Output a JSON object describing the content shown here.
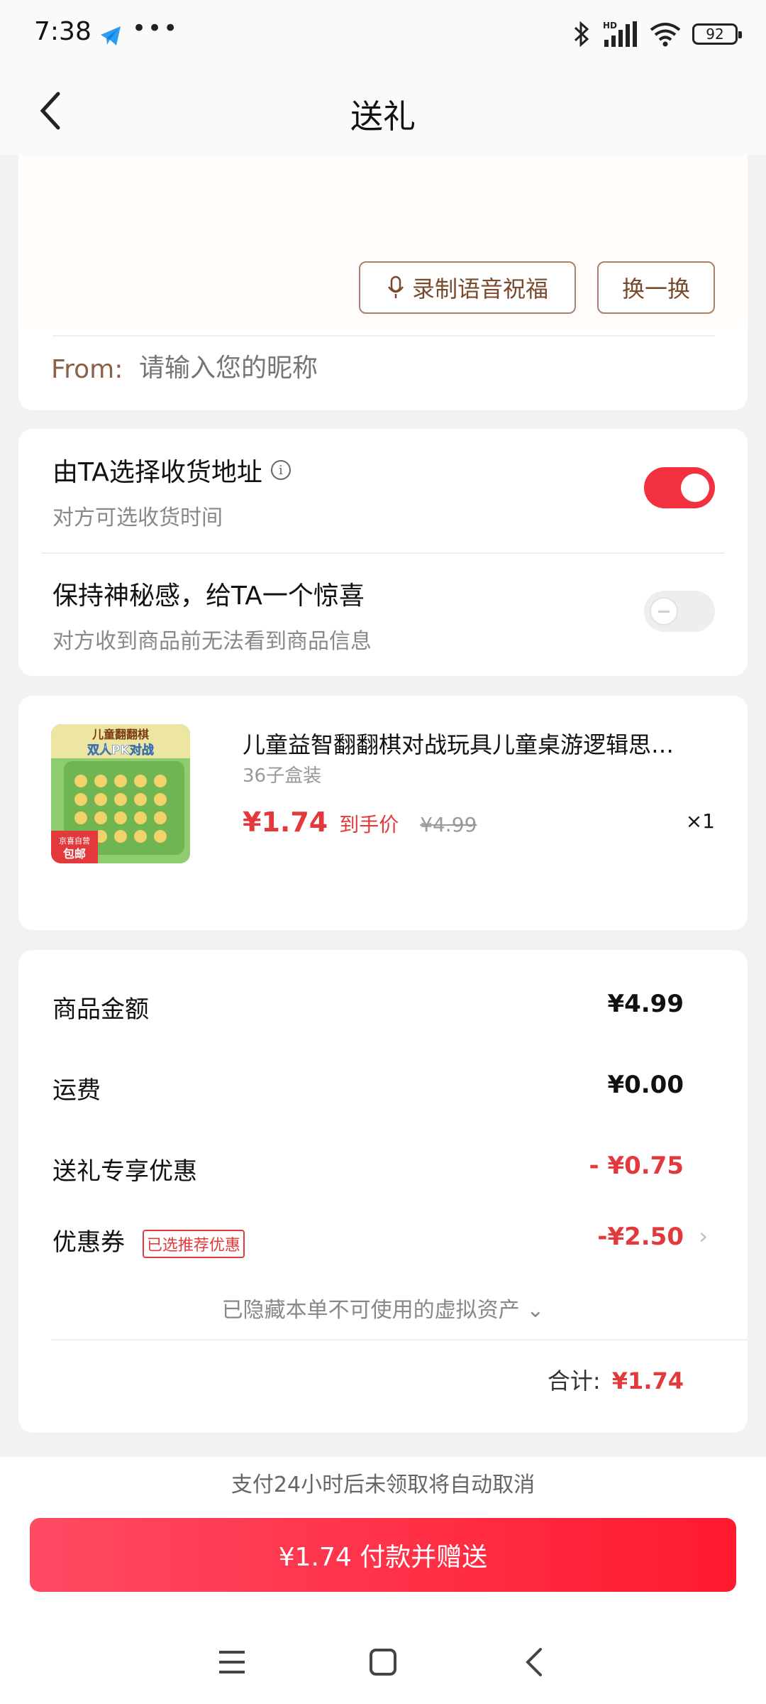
{
  "status_bar": {
    "time": "7:38",
    "more": "•••",
    "battery": "92",
    "network": "HD"
  },
  "nav": {
    "title": "送礼"
  },
  "message": {
    "record_button": "录制语音祝福",
    "switch_button": "换一换",
    "from_label": "From:",
    "from_placeholder": "请输入您的昵称"
  },
  "options": {
    "address": {
      "title": "由TA选择收货地址",
      "subtitle": "对方可选收货时间",
      "enabled": true
    },
    "mystery": {
      "title": "保持神秘感，给TA一个惊喜",
      "subtitle": "对方收到商品前无法看到商品信息",
      "enabled": false
    }
  },
  "product": {
    "image_text_top": "儿童翻翻棋",
    "image_text_mid": "双人PK对战",
    "image_badge_top": "京喜自营",
    "image_badge": "包邮",
    "name": "儿童益智翻翻棋对战玩具儿童桌游逻辑思…",
    "spec": "36子盒装",
    "price": "¥1.74",
    "price_tag": "到手价",
    "original_price": "¥4.99",
    "quantity": "×1"
  },
  "summary": {
    "goods_label": "商品金额",
    "goods_value": "¥4.99",
    "shipping_label": "运费",
    "shipping_value": "¥0.00",
    "gift_discount_label": "送礼专享优惠",
    "gift_discount_value": "- ¥0.75",
    "coupon_label": "优惠券",
    "coupon_badge": "已选推荐优惠",
    "coupon_value": "-¥2.50",
    "hidden_assets": "已隐藏本单不可使用的虚拟资产",
    "total_label": "合计:",
    "total_value": "¥1.74"
  },
  "bottom": {
    "notice": "支付24小时后未领取将自动取消",
    "pay_button": "¥1.74 付款并赠送"
  },
  "colors": {
    "accent_red": "#e4393c",
    "toggle_on": "#f23040",
    "brown": "#8a6048"
  }
}
